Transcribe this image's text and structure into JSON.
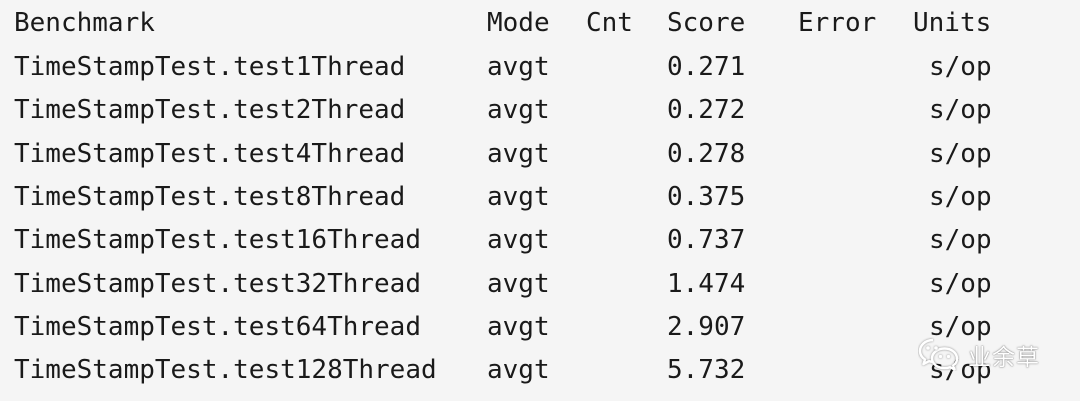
{
  "header": {
    "benchmark": "Benchmark",
    "mode": "Mode",
    "cnt": "Cnt",
    "score": "Score",
    "error": "Error",
    "units": "Units"
  },
  "rows": [
    {
      "benchmark": "TimeStampTest.test1Thread",
      "mode": "avgt",
      "cnt": "",
      "score": "0.271",
      "error": "",
      "units": "s/op"
    },
    {
      "benchmark": "TimeStampTest.test2Thread",
      "mode": "avgt",
      "cnt": "",
      "score": "0.272",
      "error": "",
      "units": "s/op"
    },
    {
      "benchmark": "TimeStampTest.test4Thread",
      "mode": "avgt",
      "cnt": "",
      "score": "0.278",
      "error": "",
      "units": "s/op"
    },
    {
      "benchmark": "TimeStampTest.test8Thread",
      "mode": "avgt",
      "cnt": "",
      "score": "0.375",
      "error": "",
      "units": "s/op"
    },
    {
      "benchmark": "TimeStampTest.test16Thread",
      "mode": "avgt",
      "cnt": "",
      "score": "0.737",
      "error": "",
      "units": "s/op"
    },
    {
      "benchmark": "TimeStampTest.test32Thread",
      "mode": "avgt",
      "cnt": "",
      "score": "1.474",
      "error": "",
      "units": "s/op"
    },
    {
      "benchmark": "TimeStampTest.test64Thread",
      "mode": "avgt",
      "cnt": "",
      "score": "2.907",
      "error": "",
      "units": "s/op"
    },
    {
      "benchmark": "TimeStampTest.test128Thread",
      "mode": "avgt",
      "cnt": "",
      "score": "5.732",
      "error": "",
      "units": "s/op"
    }
  ],
  "watermark": {
    "text": "业余草",
    "icon": "wechat-icon"
  },
  "colors": {
    "background": "#f5f5f5",
    "text": "#1a1a1a",
    "watermark": "#ffffff"
  }
}
